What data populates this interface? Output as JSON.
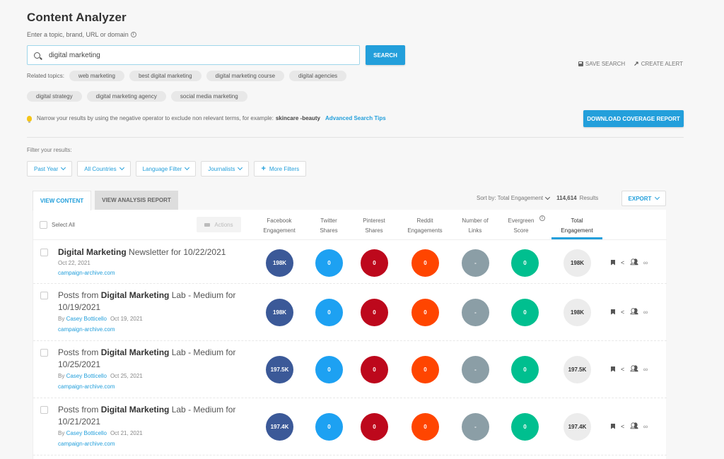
{
  "header": {
    "title": "Content Analyzer",
    "subtitle": "Enter a topic, brand, URL or domain",
    "info_icon": "info-circle-icon"
  },
  "search": {
    "value": "digital marketing",
    "placeholder": "",
    "button_label": "SEARCH"
  },
  "related": {
    "label": "Related topics:",
    "topics": [
      "web marketing",
      "best digital marketing",
      "digital marketing course",
      "digital agencies",
      "digital strategy",
      "digital marketing agency",
      "social media marketing"
    ]
  },
  "top_actions": {
    "save_search": "SAVE SEARCH",
    "create_alert": "CREATE ALERT"
  },
  "download_button": "DOWNLOAD COVERAGE REPORT",
  "tip": {
    "text": "Narrow your results by using the negative operator to exclude non relevant terms, for example:",
    "example": "skincare -beauty",
    "link": "Advanced Search Tips"
  },
  "filters": {
    "label": "Filter your results:",
    "items": [
      {
        "label": "Past Year"
      },
      {
        "label": "All Countries"
      },
      {
        "label": "Language Filter"
      },
      {
        "label": "Journalists"
      }
    ],
    "more": "More Filters"
  },
  "tabs": {
    "active": "VIEW CONTENT",
    "inactive": "VIEW ANALYSIS REPORT"
  },
  "sort": {
    "label": "Sort by: Total Engagement",
    "results_count": "114,614",
    "results_label": "Results",
    "export": "EXPORT"
  },
  "table": {
    "select_all": "Select All",
    "actions": "Actions",
    "columns": [
      {
        "line1": "Facebook",
        "line2": "Engagement"
      },
      {
        "line1": "Twitter",
        "line2": "Shares"
      },
      {
        "line1": "Pinterest",
        "line2": "Shares"
      },
      {
        "line1": "Reddit",
        "line2": "Engagements"
      },
      {
        "line1": "Number of",
        "line2": "Links"
      },
      {
        "line1": "Evergreen",
        "line2": "Score"
      },
      {
        "line1": "Total",
        "line2": "Engagement"
      }
    ],
    "colors": {
      "facebook": "#3b5998",
      "twitter": "#1da1f2",
      "pinterest": "#bd081c",
      "reddit": "#ff4500",
      "links": "#8b9ea6",
      "evergreen": "#00bf8f",
      "total": "#ececec"
    },
    "rows": [
      {
        "title_bold": "Digital Marketing",
        "title_pre": "",
        "title_post": " Newsletter for 10/22/2021",
        "author_prefix": "",
        "author": "",
        "date": "Oct 22, 2021",
        "domain": "campaign-archive.com",
        "facebook": "198K",
        "twitter": "0",
        "pinterest": "0",
        "reddit": "0",
        "links": "-",
        "evergreen": "0",
        "total": "198K"
      },
      {
        "title_bold": "Digital Marketing",
        "title_pre": "Posts from ",
        "title_post": " Lab - Medium for 10/19/2021",
        "author_prefix": "By",
        "author": "Casey Botticello",
        "date": "Oct 19, 2021",
        "domain": "campaign-archive.com",
        "facebook": "198K",
        "twitter": "0",
        "pinterest": "0",
        "reddit": "0",
        "links": "-",
        "evergreen": "0",
        "total": "198K"
      },
      {
        "title_bold": "Digital Marketing",
        "title_pre": "Posts from ",
        "title_post": " Lab - Medium for 10/25/2021",
        "author_prefix": "By",
        "author": "Casey Botticello",
        "date": "Oct 25, 2021",
        "domain": "campaign-archive.com",
        "facebook": "197.5K",
        "twitter": "0",
        "pinterest": "0",
        "reddit": "0",
        "links": "-",
        "evergreen": "0",
        "total": "197.5K"
      },
      {
        "title_bold": "Digital Marketing",
        "title_pre": "Posts from ",
        "title_post": " Lab - Medium for 10/21/2021",
        "author_prefix": "By",
        "author": "Casey Botticello",
        "date": "Oct 21, 2021",
        "domain": "campaign-archive.com",
        "facebook": "197.4K",
        "twitter": "0",
        "pinterest": "0",
        "reddit": "0",
        "links": "-",
        "evergreen": "0",
        "total": "197.4K"
      }
    ]
  }
}
